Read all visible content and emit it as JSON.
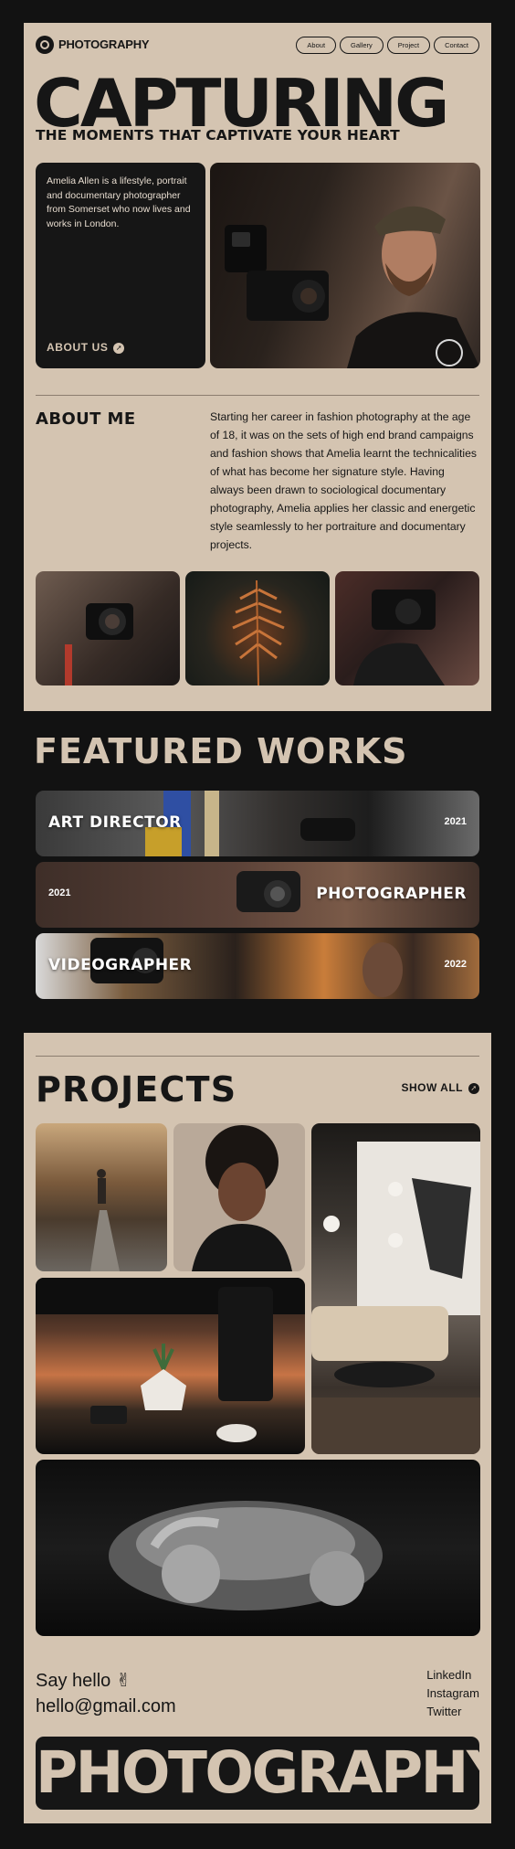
{
  "nav": {
    "logo": "PHOTOGRAPHY",
    "links": [
      "About",
      "Gallery",
      "Project",
      "Contact"
    ]
  },
  "hero": {
    "title": "CAPTURING",
    "subtitle": "THE MOMENTS THAT CAPTIVATE YOUR HEART"
  },
  "bio": {
    "text": "Amelia Allen is a lifestyle, portrait and documentary photographer from Somerset who now lives and works in London.",
    "cta": "ABOUT US"
  },
  "about": {
    "heading": "ABOUT ME",
    "body": "Starting her career in fashion photography at the age of 18, it was on the sets of high end brand campaigns and fashion shows that Amelia learnt the technicalities of what has become her signature style. Having always been drawn to sociological documentary photography, Amelia applies her classic and energetic style seamlessly to her portraiture and documentary projects."
  },
  "featured": {
    "heading": "FEATURED WORKS",
    "items": [
      {
        "title": "ART DIRECTOR",
        "year": "2021"
      },
      {
        "title": "PHOTOGRAPHER",
        "year": "2021"
      },
      {
        "title": "VIDEOGRAPHER",
        "year": "2022"
      }
    ]
  },
  "projects": {
    "heading": "PROJECTS",
    "show_all": "SHOW ALL"
  },
  "contact": {
    "greeting": "Say hello",
    "email": "hello@gmail.com",
    "social": [
      "LinkedIn",
      "Instagram",
      "Twitter"
    ]
  },
  "footer": {
    "wordmark": "PHOTOGRAPHY"
  },
  "colors": {
    "background": "#121212",
    "card": "#d4c4b1",
    "ink": "#161616"
  }
}
